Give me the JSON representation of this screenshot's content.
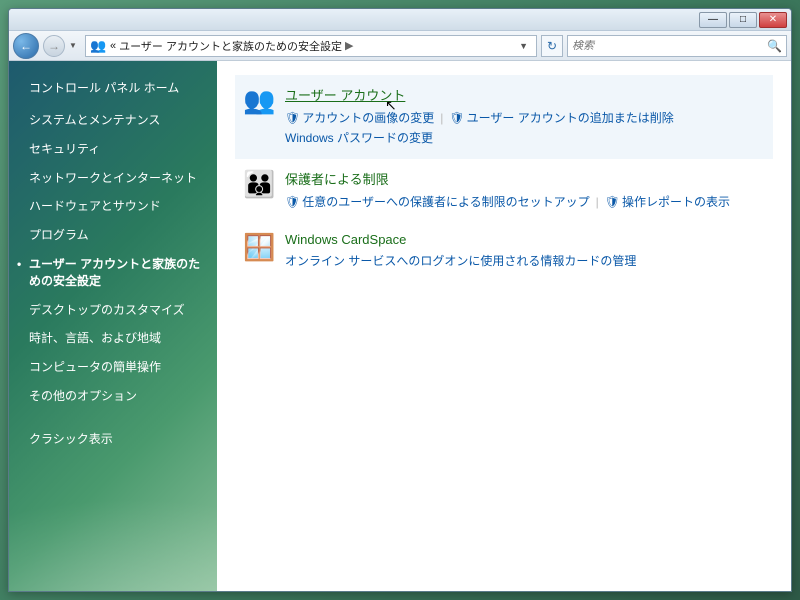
{
  "titlebar": {
    "minimize": "—",
    "maximize": "□",
    "close": "✕"
  },
  "addressbar": {
    "back": "←",
    "forward": "→",
    "prefix": "«",
    "breadcrumb": "ユーザー アカウントと家族のための安全設定",
    "arrow": "▶",
    "dropdown": "▼",
    "refresh": "↻"
  },
  "search": {
    "placeholder": "検索",
    "icon": "🔍"
  },
  "sidebar": {
    "home": "コントロール パネル ホーム",
    "items": [
      "システムとメンテナンス",
      "セキュリティ",
      "ネットワークとインターネット",
      "ハードウェアとサウンド",
      "プログラム",
      "ユーザー アカウントと家族のための安全設定",
      "デスクトップのカスタマイズ",
      "時計、言語、および地域",
      "コンピュータの簡単操作",
      "その他のオプション"
    ],
    "active_index": 5,
    "classic": "クラシック表示"
  },
  "main": {
    "sections": [
      {
        "icon": "👥",
        "title": "ユーザー アカウント",
        "highlighted": true,
        "links": [
          {
            "shield": true,
            "text": "アカウントの画像の変更"
          },
          {
            "shield": true,
            "text": "ユーザー アカウントの追加または削除"
          },
          {
            "shield": false,
            "text": "Windows パスワードの変更"
          }
        ]
      },
      {
        "icon": "👪",
        "title": "保護者による制限",
        "highlighted": false,
        "links": [
          {
            "shield": true,
            "text": "任意のユーザーへの保護者による制限のセットアップ"
          },
          {
            "shield": true,
            "text": "操作レポートの表示"
          }
        ]
      },
      {
        "icon": "🪟",
        "title": "Windows CardSpace",
        "highlighted": false,
        "links": [
          {
            "shield": false,
            "text": "オンライン サービスへのログオンに使用される情報カードの管理"
          }
        ]
      }
    ]
  }
}
